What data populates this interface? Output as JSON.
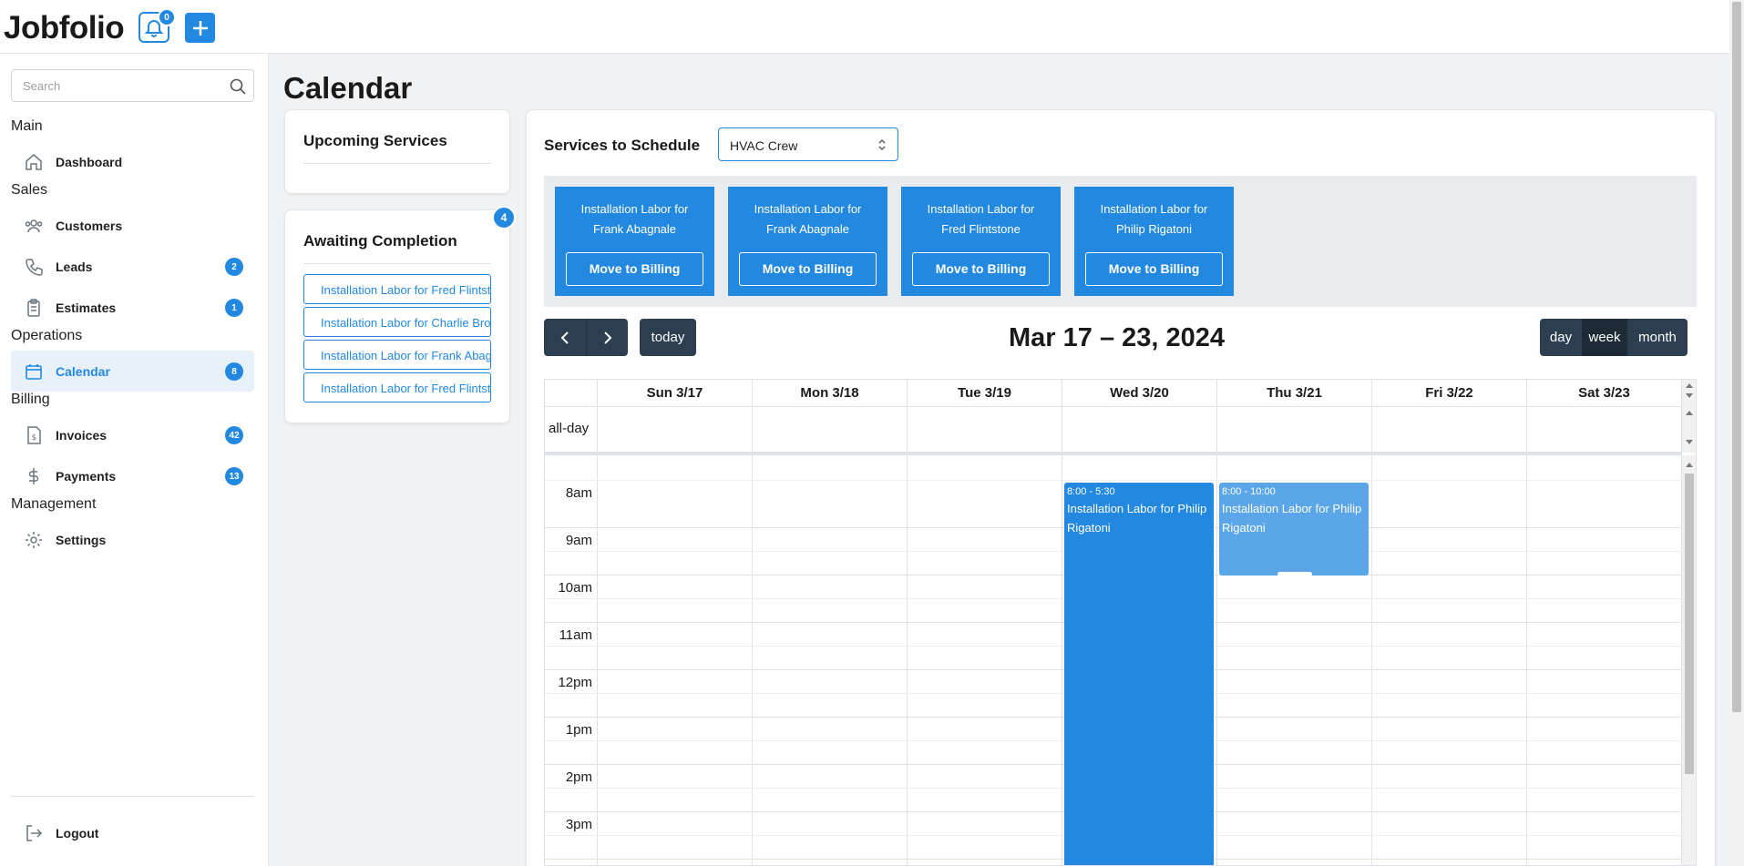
{
  "app": {
    "brand": "Jobfolio",
    "notification_count": "0"
  },
  "search": {
    "placeholder": "Search"
  },
  "sidebar": {
    "sections": {
      "main": "Main",
      "sales": "Sales",
      "operations": "Operations",
      "billing": "Billing",
      "management": "Management"
    },
    "items": [
      {
        "label": "Dashboard",
        "icon": "home-icon"
      },
      {
        "label": "Customers",
        "icon": "users-icon"
      },
      {
        "label": "Leads",
        "icon": "phone-icon",
        "badge": "2"
      },
      {
        "label": "Estimates",
        "icon": "clipboard-icon",
        "badge": "1"
      },
      {
        "label": "Calendar",
        "icon": "calendar-icon",
        "badge": "8",
        "active": true
      },
      {
        "label": "Invoices",
        "icon": "invoice-icon",
        "badge": "42"
      },
      {
        "label": "Payments",
        "icon": "dollar-icon",
        "badge": "13"
      },
      {
        "label": "Settings",
        "icon": "gear-icon"
      }
    ],
    "logout": "Logout"
  },
  "page": {
    "title": "Calendar"
  },
  "upcoming": {
    "title": "Upcoming Services"
  },
  "awaiting": {
    "title": "Awaiting Completion",
    "count": "4",
    "items": [
      "Installation Labor for Fred Flintstone",
      "Installation Labor for Charlie Brown",
      "Installation Labor for Frank Abagnale",
      "Installation Labor for Fred Flintstone"
    ]
  },
  "schedule": {
    "label": "Services to Schedule",
    "crew": "HVAC Crew",
    "move_label": "Move to Billing",
    "services": [
      {
        "line1": "Installation Labor for",
        "line2": "Frank Abagnale"
      },
      {
        "line1": "Installation Labor for",
        "line2": "Frank Abagnale"
      },
      {
        "line1": "Installation Labor for",
        "line2": "Fred Flintstone"
      },
      {
        "line1": "Installation Labor for",
        "line2": "Philip Rigatoni"
      }
    ]
  },
  "calendar": {
    "range_title": "Mar 17 – 23, 2024",
    "today_label": "today",
    "views": [
      "day",
      "week",
      "month"
    ],
    "active_view": "week",
    "days": [
      "Sun 3/17",
      "Mon 3/18",
      "Tue 3/19",
      "Wed 3/20",
      "Thu 3/21",
      "Fri 3/22",
      "Sat 3/23"
    ],
    "allday_label": "all-day",
    "times": [
      "8am",
      "9am",
      "10am",
      "11am",
      "12pm",
      "1pm",
      "2pm",
      "3pm"
    ],
    "events": [
      {
        "time": "8:00 - 5:30",
        "title": "Installation Labor for Philip Rigatoni",
        "day": "Wed 3/20",
        "color": "#2388e0"
      },
      {
        "time": "8:00 - 10:00",
        "title": "Installation Labor for Philip Rigatoni",
        "day": "Thu 3/21",
        "color": "#5ba6e8"
      }
    ]
  },
  "colors": {
    "accent": "#2388e0",
    "toolbar": "#2c3e50"
  }
}
